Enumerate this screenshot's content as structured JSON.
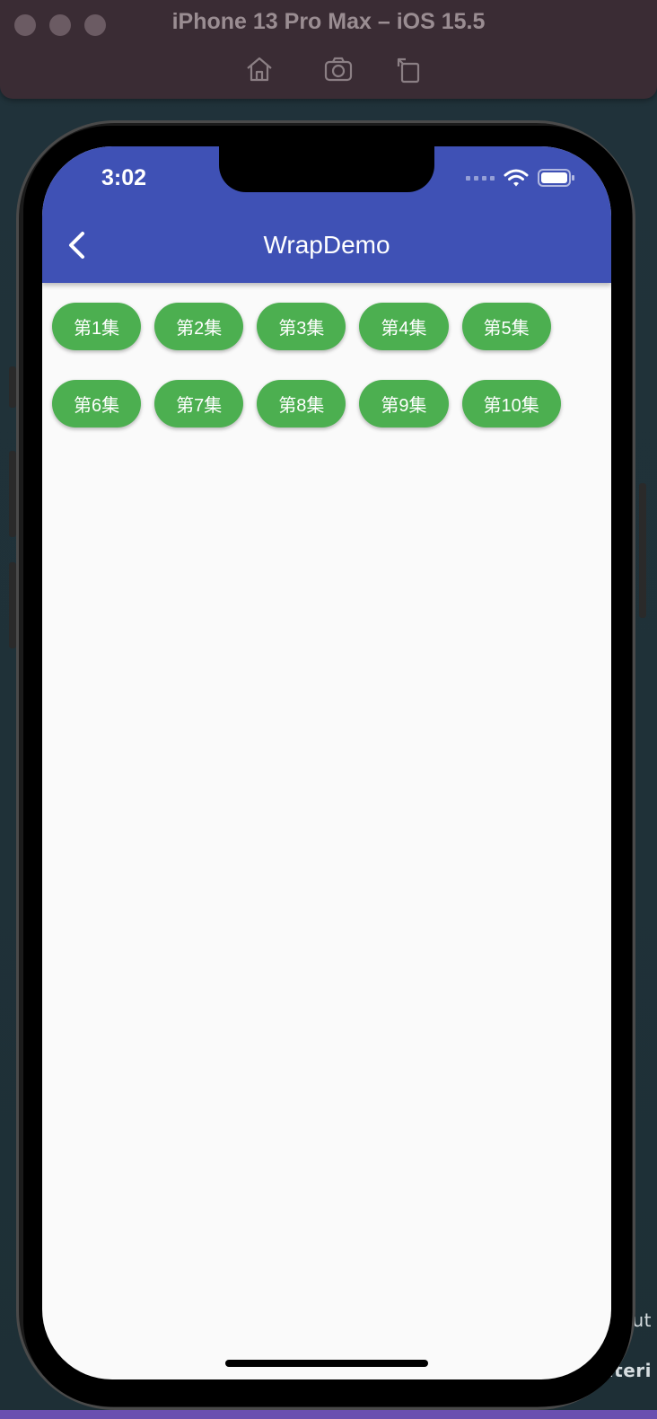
{
  "simulator": {
    "title": "iPhone 13 Pro Max – iOS 15.5",
    "toolbar": [
      "home-icon",
      "screenshot-icon",
      "rotate-icon"
    ]
  },
  "status_bar": {
    "time": "3:02"
  },
  "app_bar": {
    "title": "WrapDemo",
    "background": "#3f51b5"
  },
  "chips": {
    "color": "#4caf50",
    "items": [
      {
        "label": "第1集"
      },
      {
        "label": "第2集"
      },
      {
        "label": "第3集"
      },
      {
        "label": "第4集"
      },
      {
        "label": "第5集"
      },
      {
        "label": "第6集"
      },
      {
        "label": "第7集"
      },
      {
        "label": "第8集"
      },
      {
        "label": "第9集"
      },
      {
        "label": "第10集"
      }
    ]
  },
  "background_ide": {
    "text_top": "ut",
    "text_bottom": "ateri"
  }
}
